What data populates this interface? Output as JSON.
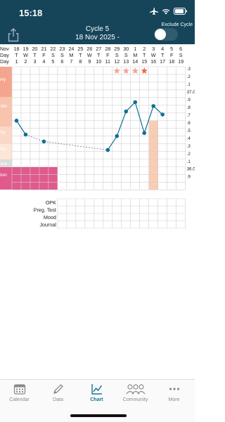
{
  "status_bar": {
    "time": "15:18"
  },
  "header": {
    "cycle_title": "Cycle 5",
    "cycle_date": "18 Nov 2025 -",
    "exclude_label": "Exclude Cycle",
    "exclude_on": false
  },
  "colors": {
    "header_bg": "#16455a",
    "accent": "#1c6f99",
    "line": "#0e6f96",
    "period": "#e05a8e",
    "highlight": "#f9cdb4",
    "star": "#f1a794"
  },
  "chart": {
    "row_labels": [
      "Nov",
      "Day",
      "Day"
    ],
    "dates": [
      "18",
      "19",
      "20",
      "21",
      "22",
      "23",
      "24",
      "25",
      "26",
      "27",
      "28",
      "29",
      "30",
      "1",
      "2",
      "3",
      "4",
      "5",
      "6"
    ],
    "weekdays": [
      "T",
      "W",
      "T",
      "F",
      "S",
      "S",
      "M",
      "T",
      "W",
      "T",
      "F",
      "S",
      "S",
      "M",
      "T",
      "W",
      "T",
      "F",
      "S"
    ],
    "cycle_days": [
      "1",
      "2",
      "3",
      "4",
      "5",
      "6",
      "7",
      "8",
      "9",
      "10",
      "11",
      "12",
      "13",
      "14",
      "15",
      "16",
      "17",
      "18",
      "19"
    ],
    "cm_labels": [
      "ery",
      "nite",
      "my",
      "cky",
      "one",
      "tion"
    ],
    "temp_labels": [
      ".3",
      ".2",
      ".1",
      "37.0",
      ".9",
      ".8",
      ".7",
      ".6",
      ".5",
      ".4",
      ".3",
      ".2",
      ".1",
      "36.0",
      ".9"
    ],
    "temperatures": [
      36.6,
      36.42,
      null,
      36.33,
      null,
      null,
      null,
      null,
      null,
      null,
      36.22,
      36.4,
      36.72,
      36.84,
      36.44,
      36.79,
      36.68
    ],
    "stars": [
      12,
      13,
      14,
      15
    ],
    "orange_star": 15,
    "period_days": [
      1,
      2,
      3,
      4,
      5
    ],
    "highlight_day": 16,
    "bottom_rows": [
      "OPK",
      "Preg. Test",
      "Mood",
      "Journal"
    ]
  },
  "tabs": [
    {
      "label": "Calendar",
      "icon": "calendar-icon"
    },
    {
      "label": "Data",
      "icon": "pencil-icon"
    },
    {
      "label": "Chart",
      "icon": "chart-icon",
      "active": true
    },
    {
      "label": "Community",
      "icon": "people-icon"
    },
    {
      "label": "More",
      "icon": "more-icon"
    }
  ]
}
